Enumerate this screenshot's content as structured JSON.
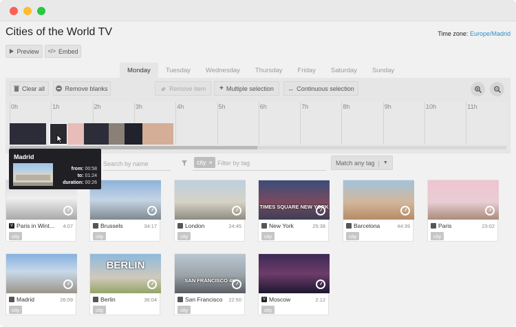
{
  "app": {
    "title": "Cities of the World TV",
    "timezone_label": "Time zone:",
    "timezone_value": "Europe/Madrid"
  },
  "toolbar": {
    "preview_label": "Preview",
    "embed_label": "Embed"
  },
  "days": [
    "Monday",
    "Tuesday",
    "Wednesday",
    "Thursday",
    "Friday",
    "Saturday",
    "Sunday"
  ],
  "active_day": "Monday",
  "actions": {
    "clear_all": "Clear all",
    "remove_blanks": "Remove blanks",
    "remove_item": "Remove item",
    "multiple_selection": "Multiple selection",
    "continuous_selection": "Continuous selection"
  },
  "timeline": {
    "hours": [
      "0h",
      "1h",
      "2h",
      "3h",
      "4h",
      "5h",
      "6h",
      "7h",
      "8h",
      "9h",
      "10h",
      "11h"
    ]
  },
  "tooltip": {
    "title": "Madrid",
    "from_label": "from:",
    "from": "00:58",
    "to_label": "to:",
    "to": "01:24",
    "duration_label": "duration:",
    "duration": "00:26"
  },
  "filters": {
    "search_placeholder": "Search by name",
    "tag_placeholder": "Filter by tag",
    "tag_value": "city",
    "match_label": "Match any tag"
  },
  "videos": [
    {
      "name": "Paris in Wint...",
      "duration": "4:07",
      "source": "vimeo",
      "tag": "city"
    },
    {
      "name": "Brussels",
      "duration": "34:17",
      "source": "youtube",
      "tag": "city"
    },
    {
      "name": "London",
      "duration": "24:45",
      "source": "youtube",
      "tag": "city"
    },
    {
      "name": "New York",
      "duration": "25:38",
      "source": "youtube",
      "tag": "city",
      "overlay": "TIMES SQUARE NEW YORK"
    },
    {
      "name": "Barcelona",
      "duration": "44:39",
      "source": "youtube",
      "tag": "city"
    },
    {
      "name": "Paris",
      "duration": "23:02",
      "source": "youtube",
      "tag": "city"
    },
    {
      "name": "Madrid",
      "duration": "26:09",
      "source": "youtube",
      "tag": "city"
    },
    {
      "name": "Berlin",
      "duration": "36:04",
      "source": "youtube",
      "tag": "city",
      "overlay": "BERLIN"
    },
    {
      "name": "San Francisco",
      "duration": "22:50",
      "source": "youtube",
      "tag": "city",
      "overlay": "SAN FRANCISCO 4K"
    },
    {
      "name": "Moscow",
      "duration": "2:12",
      "source": "vimeo",
      "tag": "city"
    }
  ]
}
